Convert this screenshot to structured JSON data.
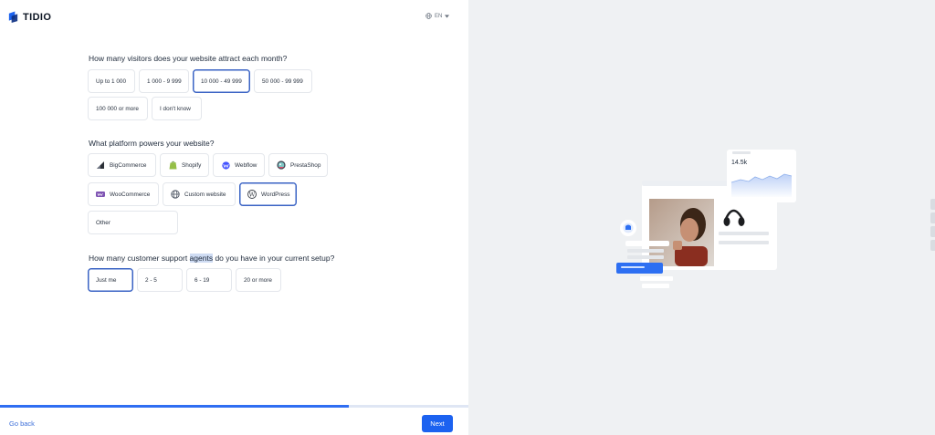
{
  "brand": {
    "name": "TIDIO"
  },
  "language": {
    "code": "EN"
  },
  "questions": {
    "visitors": {
      "prompt": "How many visitors does your website attract each month?",
      "options": [
        "Up to 1 000",
        "1 000 - 9 999",
        "10 000 - 49 999",
        "50 000 - 99 999",
        "100 000 or more",
        "I don't know"
      ],
      "selected": "10 000 - 49 999"
    },
    "platform": {
      "prompt": "What platform powers your website?",
      "options": [
        "BigCommerce",
        "Shopify",
        "Webflow",
        "PrestaShop",
        "WooCommerce",
        "Custom website",
        "WordPress",
        "Other"
      ],
      "selected": "WordPress"
    },
    "agents": {
      "prompt_before": "How many customer support ",
      "prompt_highlight": "agents",
      "prompt_after": " do you have in your current setup?",
      "options": [
        "Just me",
        "2 - 5",
        "6 - 19",
        "20 or more"
      ],
      "selected": "Just me"
    }
  },
  "progress": {
    "fraction": 0.745
  },
  "footer": {
    "back_label": "Go back",
    "next_label": "Next"
  },
  "illustration": {
    "stat_value": "14.5k"
  },
  "colors": {
    "accent": "#1c62f0",
    "selected_border": "#3a63c4",
    "right_panel": "#eff1f3"
  }
}
